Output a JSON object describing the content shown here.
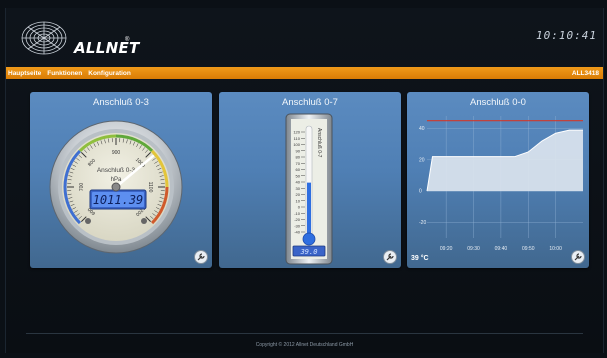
{
  "header": {
    "logo_text": "ALLNET",
    "logo_reg": "®",
    "clock": "10:10:41"
  },
  "nav": {
    "items": [
      "Hauptseite",
      "Funktionen",
      "Konfiguration"
    ],
    "device": "ALL3418"
  },
  "gauge_panel": {
    "title": "Anschluß 0-3",
    "face_label": "Anschluß 0-3",
    "unit": "hPa",
    "display": "1011.39",
    "value": 1011.39,
    "scale_min": 600,
    "scale_max": 1200,
    "ticks": [
      "600",
      "700",
      "800",
      "900",
      "1000",
      "1100",
      "1200"
    ]
  },
  "thermo_panel": {
    "title": "Anschluß 0-7",
    "tube_label": "Anschluß 0-7",
    "display": "39.0",
    "value": 39.0,
    "scale_min": -40,
    "scale_max": 120,
    "ticks": [
      "120",
      "110",
      "100",
      "90",
      "80",
      "70",
      "60",
      "50",
      "40",
      "30",
      "20",
      "10",
      "0",
      "-10",
      "-20",
      "-30",
      "-40"
    ]
  },
  "chart_panel": {
    "title": "Anschluß 0-0",
    "current": "39 °C",
    "chart_data": {
      "type": "area",
      "x": [
        "09:13",
        "09:15",
        "09:20",
        "09:25",
        "09:30",
        "09:35",
        "09:40",
        "09:45",
        "09:50",
        "09:55",
        "10:00",
        "10:05",
        "10:10"
      ],
      "values": [
        0,
        22,
        22,
        22,
        22,
        22,
        22,
        22,
        25,
        32,
        37,
        39,
        39
      ],
      "xticks": [
        "09:20",
        "09:30",
        "09:40",
        "09:50",
        "10:00"
      ],
      "yticks": [
        "40",
        "20",
        "0",
        "-20"
      ],
      "ylim": [
        -30,
        48
      ],
      "threshold": 45,
      "grid": true
    }
  },
  "footer": {
    "copyright": "Copyright © 2012 Allnet Deutschland GmbH"
  },
  "colors": {
    "accent": "#e88e0e",
    "panel": "#5585bb",
    "threshold": "#d0392b",
    "lcd": "#4a78d8"
  }
}
